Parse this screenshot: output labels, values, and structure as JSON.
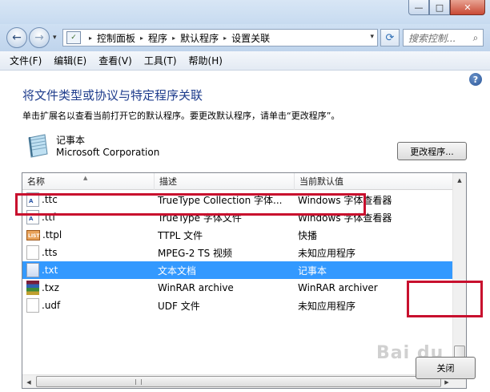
{
  "window": {
    "controls": {
      "minimize": "—",
      "maximize": "□",
      "close": "✕"
    }
  },
  "address_bar": {
    "back_glyph": "←",
    "forward_glyph": "→",
    "history_glyph": "▾",
    "icon_glyph": "✓",
    "breadcrumbs": [
      "控制面板",
      "程序",
      "默认程序",
      "设置关联"
    ],
    "crumb_separator": "▸",
    "dropdown_glyph": "▾",
    "refresh_glyph": "⟳",
    "search_placeholder": "搜索控制...",
    "search_glyph": "⌕"
  },
  "menu": [
    "文件(F)",
    "编辑(E)",
    "查看(V)",
    "工具(T)",
    "帮助(H)"
  ],
  "help_glyph": "?",
  "heading": "将文件类型或协议与特定程序关联",
  "description": "单击扩展名以查看当前打开它的默认程序。要更改默认程序，请单击“更改程序”。",
  "program": {
    "name": "记事本",
    "vendor": "Microsoft Corporation"
  },
  "change_button": "更改程序...",
  "list": {
    "columns": [
      "名称",
      "描述",
      "当前默认值"
    ],
    "sort_glyph": "▲",
    "rows": [
      {
        "name": ".ttc",
        "description": "TrueType Collection 字体...",
        "default": "Windows 字体查看器",
        "icon": "font-file-icon",
        "mark": "A"
      },
      {
        "name": ".ttf",
        "description": "TrueType 字体文件",
        "default": "Windows 字体查看器",
        "icon": "font-file-icon",
        "mark": "A"
      },
      {
        "name": ".ttpl",
        "description": "TTPL 文件",
        "default": "快播",
        "icon": "ttpl-file-icon",
        "mark": "LIST"
      },
      {
        "name": ".tts",
        "description": "MPEG-2 TS 视频",
        "default": "未知应用程序",
        "icon": "blank-file-icon",
        "mark": ""
      },
      {
        "name": ".txt",
        "description": "文本文档",
        "default": "记事本",
        "icon": "text-file-icon",
        "mark": ""
      },
      {
        "name": ".txz",
        "description": "WinRAR archive",
        "default": "WinRAR archiver",
        "icon": "winrar-archive-icon",
        "mark": ""
      },
      {
        "name": ".udf",
        "description": "UDF 文件",
        "default": "未知应用程序",
        "icon": "blank-file-icon",
        "mark": ""
      }
    ],
    "selected_index": 4
  },
  "scroll_glyphs": {
    "up": "▲",
    "down": "▼",
    "left": "◀",
    "right": "▶"
  },
  "close_button": "关闭",
  "watermark": "Bai du",
  "colors": {
    "selection": "#3399ff",
    "heading": "#1e3c8c",
    "highlight": "#c8102e"
  }
}
